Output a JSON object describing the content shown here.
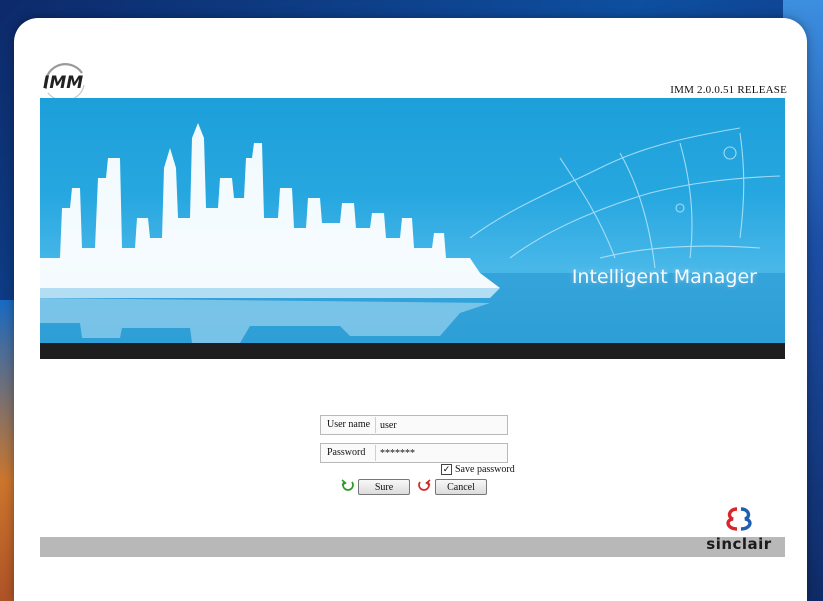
{
  "app": {
    "logo_text": "IMM",
    "version": "IMM 2.0.0.51 RELEASE"
  },
  "banner": {
    "title": "Intelligent Manager"
  },
  "login": {
    "username_label": "User name",
    "username_value": "user",
    "password_label": "Password",
    "password_value": "*******",
    "save_password_label": "Save password",
    "save_password_checked": true,
    "sure_label": "Sure",
    "cancel_label": "Cancel"
  },
  "brand": {
    "name": "sinclair"
  },
  "colors": {
    "banner_blue": "#27a7e0",
    "bar_dark": "#1e1e1e",
    "footer_gray": "#b8b8b8",
    "brand_red": "#d9262a",
    "brand_blue": "#1f5fb0"
  }
}
